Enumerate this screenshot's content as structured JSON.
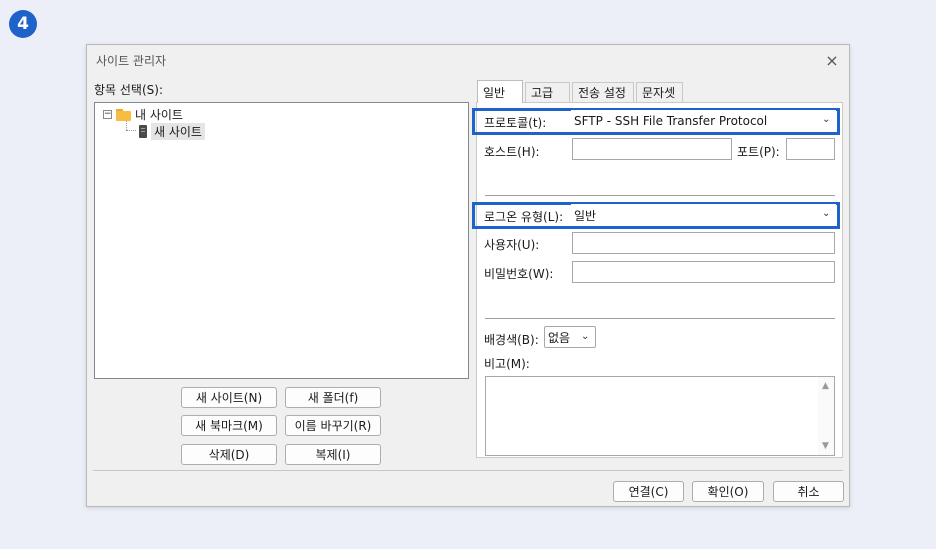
{
  "step_badge": "4",
  "dialog": {
    "title": "사이트 관리자",
    "close_icon": "×"
  },
  "tree": {
    "label": "항목 선택(S):",
    "expander": "−",
    "root_label": "내 사이트",
    "child_label": "새 사이트"
  },
  "left_buttons": {
    "new_site": "새 사이트(N)",
    "new_folder": "새 폴더(f)",
    "new_bookmark": "새 북마크(M)",
    "rename": "이름 바꾸기(R)",
    "delete": "삭제(D)",
    "duplicate": "복제(I)"
  },
  "tabs": [
    "일반",
    "고급",
    "전송 설정",
    "문자셋"
  ],
  "general": {
    "protocol_label": "프로토콜(t):",
    "protocol_value": "SFTP - SSH File Transfer Protocol",
    "host_label": "호스트(H):",
    "host_value": "",
    "port_label": "포트(P):",
    "port_value": "",
    "logon_label": "로그온 유형(L):",
    "logon_value": "일반",
    "user_label": "사용자(U):",
    "user_value": "",
    "password_label": "비밀번호(W):",
    "password_value": "",
    "bgcolor_label": "배경색(B):",
    "bgcolor_value": "없음",
    "comment_label": "비고(M):"
  },
  "footer": {
    "connect": "연결(C)",
    "ok": "확인(O)",
    "cancel": "취소"
  },
  "colors": {
    "accent": "#1e63c9",
    "highlight_border": "#1e63c9",
    "folder": "#f6bd41"
  }
}
